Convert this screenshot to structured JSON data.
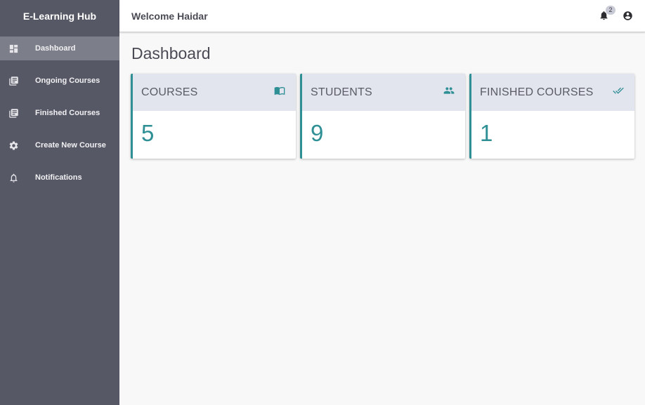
{
  "sidebar": {
    "brand": "E-Learning Hub",
    "items": [
      {
        "label": "Dashboard",
        "icon": "dashboard-icon",
        "active": true
      },
      {
        "label": "Ongoing Courses",
        "icon": "library-books-icon"
      },
      {
        "label": "Finished Courses",
        "icon": "library-books-icon"
      },
      {
        "label": "Create New Course",
        "icon": "gear-icon"
      },
      {
        "label": "Notifications",
        "icon": "bell-outline-icon"
      }
    ]
  },
  "header": {
    "welcome": "Welcome Haidar",
    "notification_count": "2",
    "icons": [
      "bell-icon",
      "account-circle-icon"
    ]
  },
  "main": {
    "title": "Dashboard",
    "cards": [
      {
        "label": "COURSES",
        "value": "5",
        "icon": "book-open-icon"
      },
      {
        "label": "STUDENTS",
        "value": "9",
        "icon": "people-icon"
      },
      {
        "label": "FINISHED COURSES",
        "value": "1",
        "icon": "double-check-icon"
      }
    ]
  },
  "colors": {
    "sidebar_bg": "#565865",
    "sidebar_active": "#7c7e89",
    "accent": "#2e8f95",
    "card_header_bg": "#e2e4ee",
    "page_bg": "#f8f8f8"
  }
}
